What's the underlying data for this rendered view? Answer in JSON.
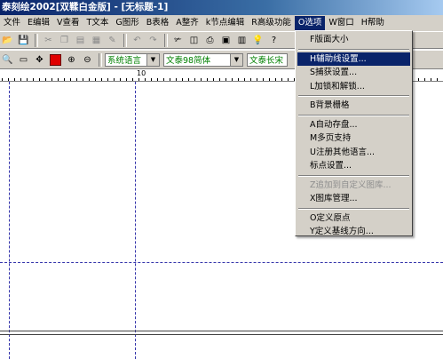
{
  "window": {
    "title": "泰刻绘2002[双鞣白金版] - [无标题-1]"
  },
  "menubar": {
    "items": [
      "文件",
      "E编辑",
      "V查看",
      "T文本",
      "G图形",
      "B表格",
      "A整齐",
      "k节点编辑",
      "R高级功能",
      "O选项",
      "W窗口",
      "H帮助"
    ]
  },
  "toolbar2": {
    "language_combo": "系统语言",
    "font_combo": "文泰98简体",
    "style_combo": "文泰长宋"
  },
  "ruler": {
    "label": "10"
  },
  "options_menu": {
    "items": [
      {
        "label": "F版面大小",
        "state": "normal"
      },
      {
        "label": "H辅助线设置...",
        "state": "highlighted"
      },
      {
        "label": "S捕获设置...",
        "state": "normal"
      },
      {
        "label": "L加锁和解锁...",
        "state": "normal"
      },
      {
        "label": "B背景栅格",
        "state": "normal"
      },
      {
        "label": "A自动存盘...",
        "state": "normal"
      },
      {
        "label": "M多页支持",
        "state": "normal"
      },
      {
        "label": "U注册其他语言...",
        "state": "normal"
      },
      {
        "label": "标点设置...",
        "state": "normal"
      },
      {
        "label": "Z追加到自定义图库...",
        "state": "disabled"
      },
      {
        "label": "X图库管理...",
        "state": "normal"
      },
      {
        "label": "O定义原点",
        "state": "normal"
      },
      {
        "label": "Y定义基线方向...",
        "state": "normal"
      }
    ]
  },
  "colors": {
    "titlebar": "#0a246a",
    "menu_highlight": "#0a246a",
    "guide": "#3333aa",
    "chrome": "#d4d0c8"
  }
}
